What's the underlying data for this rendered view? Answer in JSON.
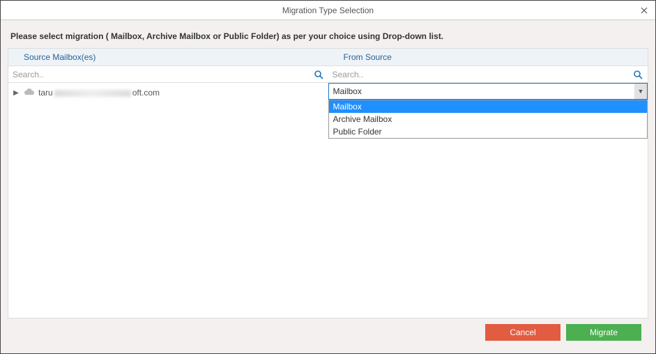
{
  "titlebar": {
    "title": "Migration Type Selection"
  },
  "instruction": "Please select migration ( Mailbox, Archive Mailbox or Public Folder) as per your choice using Drop-down list.",
  "leftPanel": {
    "header": "Source Mailbox(es)",
    "searchPlaceholder": "Search..",
    "mailboxPrefix": "taru",
    "mailboxSuffix": "oft.com"
  },
  "rightPanel": {
    "header": "From Source",
    "searchPlaceholder": "Search..",
    "dropdown": {
      "selected": "Mailbox",
      "options": [
        "Mailbox",
        "Archive Mailbox",
        "Public Folder"
      ]
    }
  },
  "buttons": {
    "cancel": "Cancel",
    "migrate": "Migrate"
  }
}
